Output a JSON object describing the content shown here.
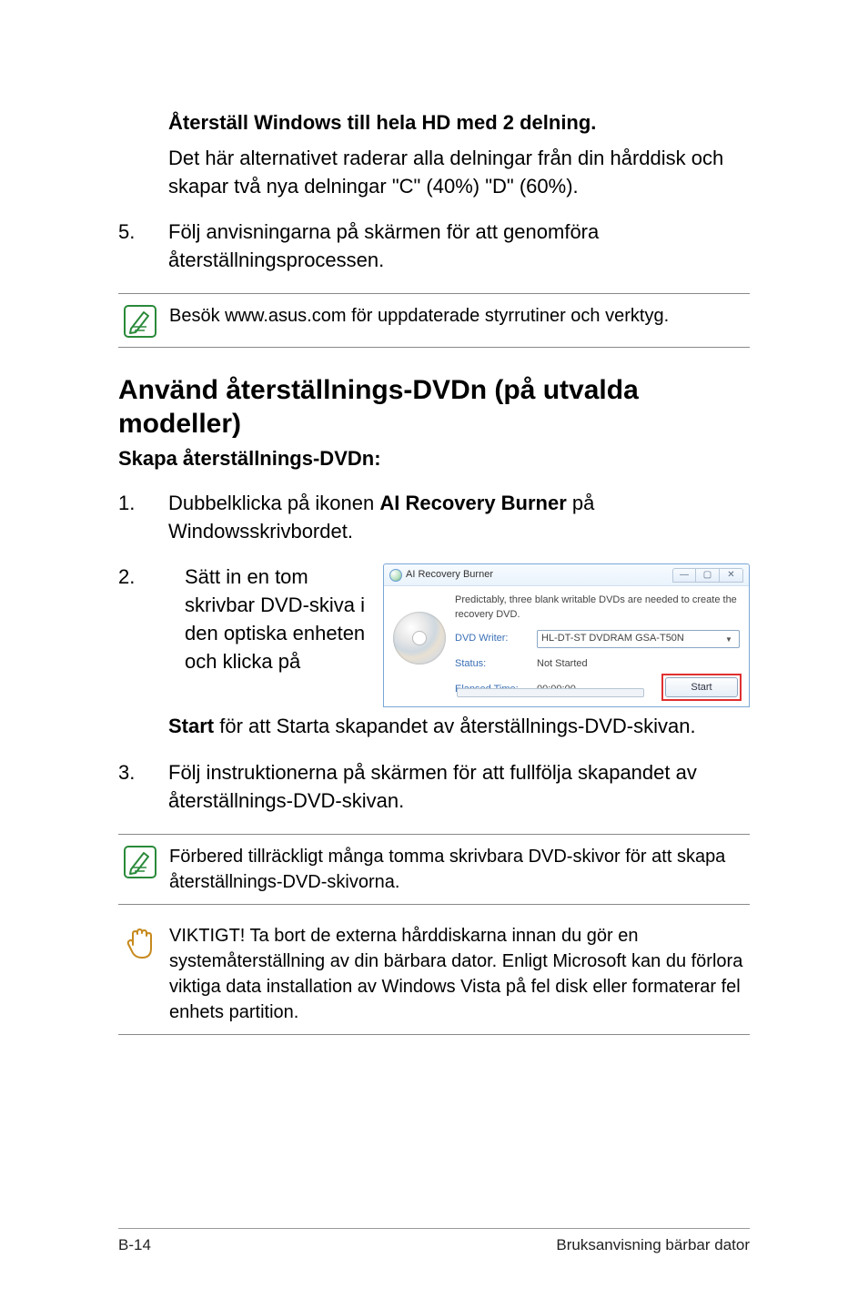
{
  "top": {
    "sub_heading": "Återställ Windows till hela HD med 2 delning.",
    "sub_para": "Det här alternativet raderar alla delningar från din hårddisk och skapar två nya delningar \"C\" (40%) \"D\" (60%).",
    "step5_num": "5.",
    "step5_text": "Följ anvisningarna på skärmen för att genomföra återställningsprocessen.",
    "note1": "Besök www.asus.com för uppdaterade styrrutiner och verktyg."
  },
  "section": {
    "title": "Använd återställnings-DVDn (på utvalda modeller)",
    "subtitle": "Skapa återställnings-DVDn:",
    "step1_num": "1.",
    "step1_pre": "Dubbelklicka på ikonen ",
    "step1_bold": "AI Recovery Burner",
    "step1_post": " på Windowsskrivbordet.",
    "step2_num": "2.",
    "step2_text": "Sätt in en tom skrivbar DVD-skiva i den optiska enheten och klicka på ",
    "step2_cont_bold": "Start",
    "step2_cont_rest": " för att Starta skapandet av återställnings-DVD-skivan.",
    "step3_num": "3.",
    "step3_text": "Följ instruktionerna på skärmen för att fullfölja skapandet av återställnings-DVD-skivan.",
    "note2": "Förbered tillräckligt många tomma skrivbara DVD-skivor för att skapa återställnings-DVD-skivorna.",
    "note3": "VIKTIGT! Ta bort de externa hårddiskarna innan du gör en systemåterställning av din bärbara dator. Enligt Microsoft kan du förlora viktiga data installation av Windows Vista på fel disk eller formaterar fel enhets partition."
  },
  "screenshot": {
    "app_title": "AI Recovery Burner",
    "predict_line": "Predictably, three blank writable DVDs are needed to create the recovery DVD.",
    "label_writer": "DVD Writer:",
    "writer_value": "HL-DT-ST DVDRAM GSA-T50N",
    "label_status": "Status:",
    "status_value": "Not Started",
    "label_elapsed": "Elapsed Time:",
    "elapsed_value": "00:00:00",
    "start_label": "Start"
  },
  "footer": {
    "left": "B-14",
    "right": "Bruksanvisning bärbar dator"
  }
}
